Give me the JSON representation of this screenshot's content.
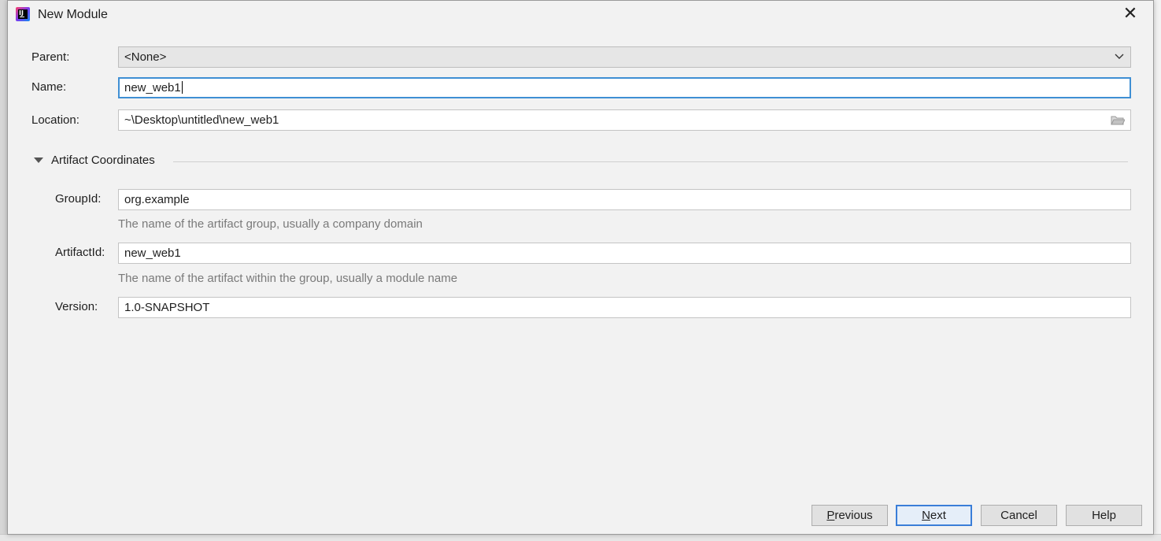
{
  "window": {
    "title": "New Module",
    "close_glyph": "✕"
  },
  "form": {
    "parent": {
      "label": "Parent:",
      "value": "<None>"
    },
    "name": {
      "label": "Name:",
      "value": "new_web1"
    },
    "location": {
      "label": "Location:",
      "value": "~\\Desktop\\untitled\\new_web1"
    }
  },
  "artifact": {
    "section_title": "Artifact Coordinates",
    "group_id": {
      "label": "GroupId:",
      "value": "org.example",
      "hint": "The name of the artifact group, usually a company domain"
    },
    "artifact_id": {
      "label": "ArtifactId:",
      "value": "new_web1",
      "hint": "The name of the artifact within the group, usually a module name"
    },
    "version": {
      "label": "Version:",
      "value": "1.0-SNAPSHOT"
    }
  },
  "buttons": {
    "previous": {
      "mnemonic": "P",
      "rest": "revious"
    },
    "next": {
      "mnemonic": "N",
      "rest": "ext"
    },
    "cancel": "Cancel",
    "help": "Help"
  },
  "icons": {
    "app": "intellij-idea-icon",
    "dropdown": "chevron-down-icon",
    "browse": "folder-icon",
    "toggle": "triangle-down-icon"
  },
  "colors": {
    "focus_border": "#3f8fd4",
    "dialog_bg": "#f2f2f2",
    "hint_text": "#7a7a7a"
  }
}
